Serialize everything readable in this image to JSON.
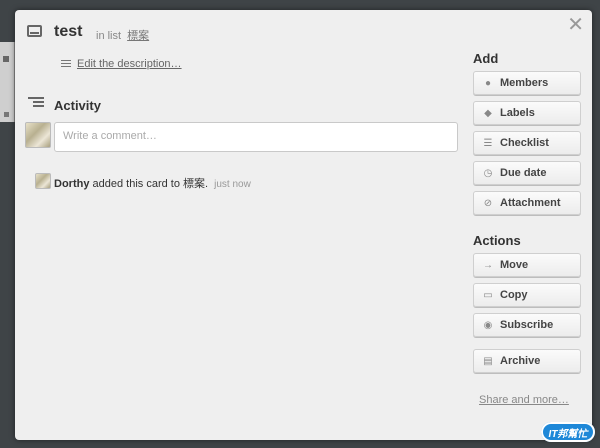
{
  "card": {
    "title": "test",
    "in_list_prefix": "in list",
    "list_name": "標案",
    "edit_description": "Edit the description…"
  },
  "activity": {
    "heading": "Activity",
    "comment_placeholder": "Write a comment…",
    "entry": {
      "user": "Dorthy",
      "action": "added this card to 標案.",
      "time": "just now"
    }
  },
  "sidebar": {
    "add_heading": "Add",
    "add_buttons": [
      {
        "label": "Members",
        "icon": "person-icon"
      },
      {
        "label": "Labels",
        "icon": "tag-icon"
      },
      {
        "label": "Checklist",
        "icon": "checklist-icon"
      },
      {
        "label": "Due date",
        "icon": "clock-icon"
      },
      {
        "label": "Attachment",
        "icon": "paperclip-icon"
      }
    ],
    "actions_heading": "Actions",
    "action_buttons": [
      {
        "label": "Move",
        "icon": "arrow-right-icon"
      },
      {
        "label": "Copy",
        "icon": "card-icon"
      },
      {
        "label": "Subscribe",
        "icon": "eye-icon"
      },
      {
        "label": "Archive",
        "icon": "archive-icon"
      }
    ],
    "share_link": "Share and more…"
  },
  "watermark": "IT邦幫忙"
}
